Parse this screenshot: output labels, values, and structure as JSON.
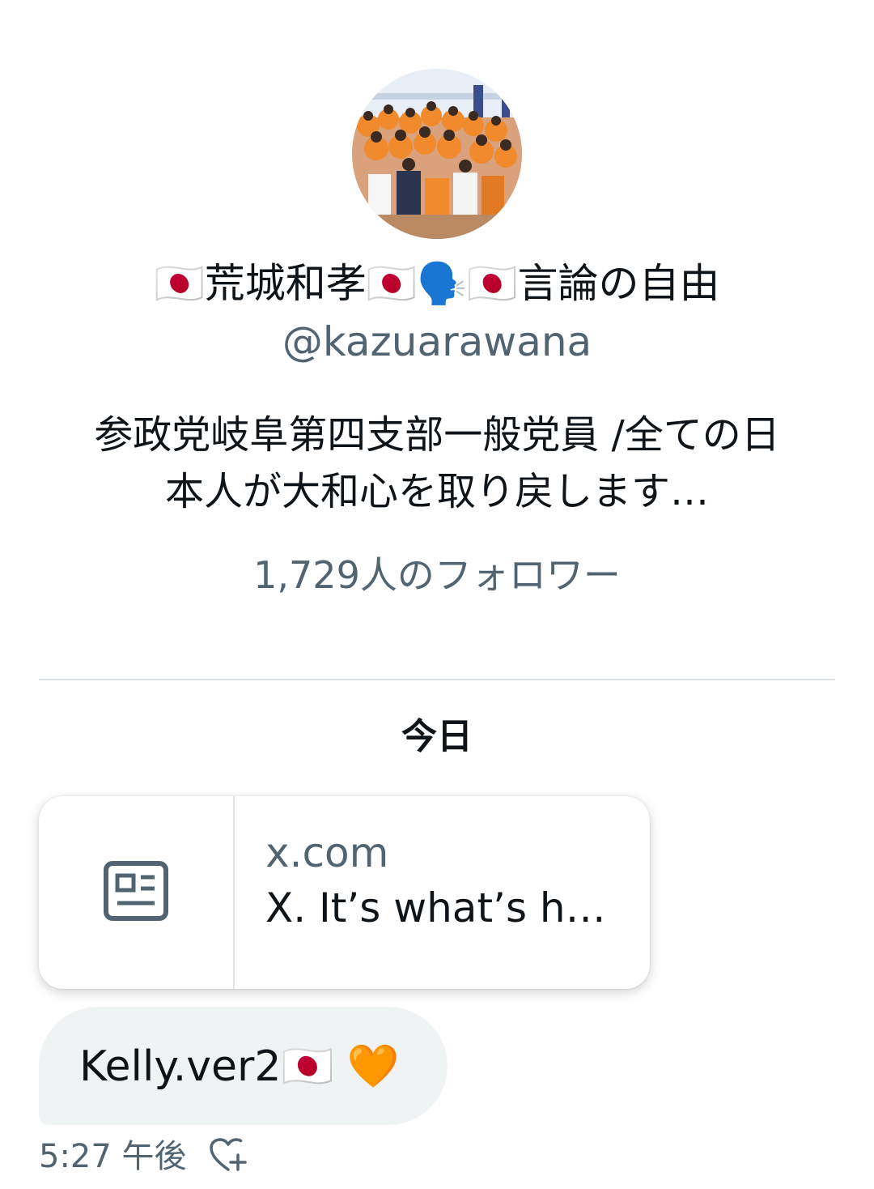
{
  "profile": {
    "display_name": "🇯🇵荒城和孝🇯🇵🗣️🇯🇵言論の自由",
    "handle": "@kazuarawana",
    "bio": "参政党岐阜第四支部一般党員 /全ての日本人が大和心を取り戻します…",
    "followers": "1,729人のフォロワー"
  },
  "conversation": {
    "date_separator": "今日",
    "link_card": {
      "icon": "article-icon",
      "domain": "x.com",
      "title": "X. It’s what’s h…"
    },
    "message": {
      "text": "Kelly.ver2🇯🇵 🧡"
    },
    "timestamp": "5:27 午後",
    "reaction_icon": "add-reaction-heart-icon"
  },
  "colors": {
    "text_primary": "#0f1419",
    "text_secondary": "#536471",
    "bubble_bg": "#eff3f4",
    "divider": "#dde2e6"
  }
}
